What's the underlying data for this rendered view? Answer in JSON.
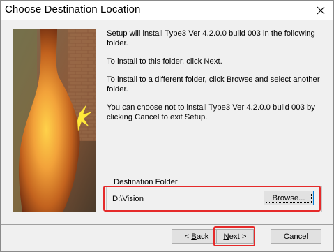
{
  "window": {
    "title": "Choose Destination Location",
    "close_glyph": "✕"
  },
  "message": {
    "line1": "Setup will install Type3 Ver 4.2.0.0 build 003 in the following folder.",
    "line2": "To install to this folder, click Next.",
    "line3": "To install to a different folder, click Browse and select another folder.",
    "line4": "You can choose not to install Type3 Ver 4.2.0.0 build 003 by clicking Cancel to exit Setup."
  },
  "destination": {
    "group_label": "Destination Folder",
    "path": "D:\\Vision",
    "browse_label": "Browse..."
  },
  "buttons": {
    "back_prefix": "< ",
    "back_access": "B",
    "back_rest": "ack",
    "next_access": "N",
    "next_rest": "ext >",
    "cancel_label": "Cancel"
  },
  "colors": {
    "highlight": "#e52a2a",
    "window_bg": "#f0f0f0",
    "button_face": "#e1e1e1"
  }
}
